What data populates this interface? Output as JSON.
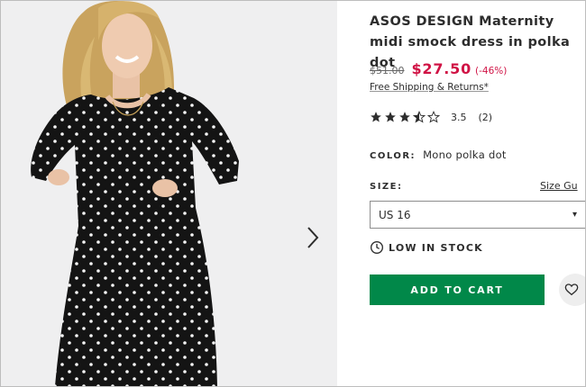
{
  "product": {
    "title": "ASOS DESIGN Maternity midi smock dress in polka dot",
    "was_price": "$51.00",
    "now_price": "$27.50",
    "discount": "(-46%)",
    "shipping": "Free Shipping & Returns*",
    "rating": {
      "value": "3.5",
      "count": "(2)",
      "stars": 3.5
    },
    "color": {
      "label": "COLOR:",
      "value": "Mono polka dot"
    },
    "size": {
      "label": "SIZE:",
      "guide": "Size Gu",
      "selected": "US 16"
    },
    "stock": "LOW IN STOCK",
    "add_to_cart": "ADD TO CART"
  },
  "icons": {
    "next": "chevron-right-icon",
    "clock": "clock-icon",
    "heart": "heart-icon",
    "star": "star-icon"
  },
  "colors": {
    "price_red": "#d01345",
    "cart_green": "#018849",
    "gallery_bg": "#efeff0"
  }
}
